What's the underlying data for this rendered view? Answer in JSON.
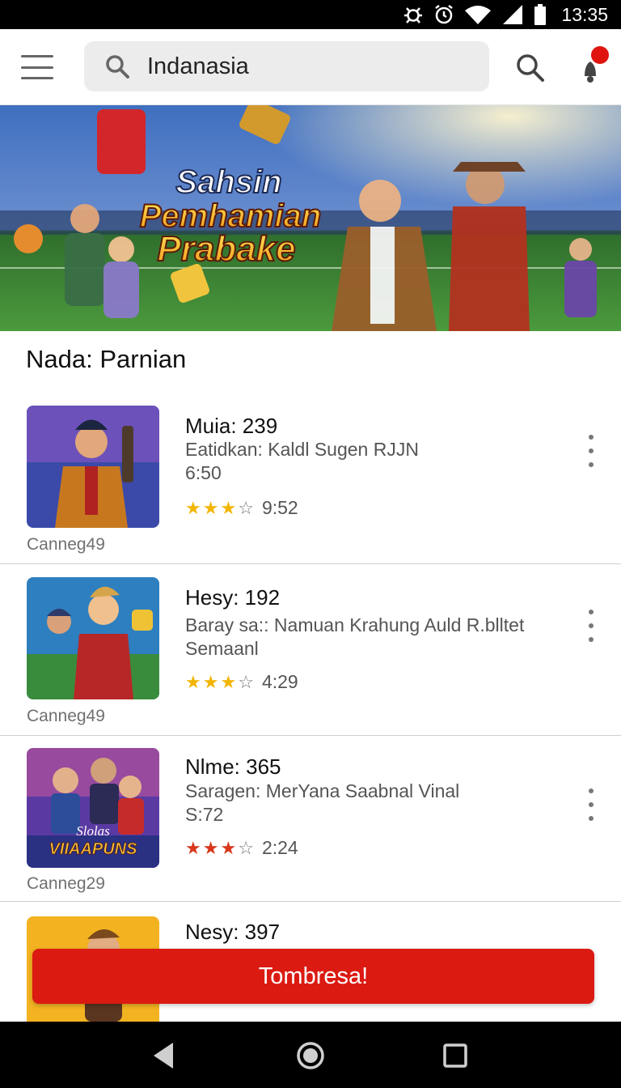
{
  "status_bar": {
    "time": "13:35",
    "icons": [
      "bug-icon",
      "alarm-icon",
      "wifi-icon",
      "signal-icon",
      "battery-icon"
    ]
  },
  "app_bar": {
    "menu_icon": "menu-icon",
    "search": {
      "value": "Indanasia",
      "icon": "search-icon"
    },
    "search_button_icon": "search-icon",
    "notification_icon": "notification-icon",
    "notification_badge_color": "#e0140f"
  },
  "banner": {
    "line1": "Sahsin",
    "line2": "Pemhamian",
    "line3": "Prabake"
  },
  "section_title": "Nada: Parnian",
  "items": [
    {
      "title": "Muia: 239",
      "desc_line1": "Eatidkan: Kaldl Sugen RJJN",
      "desc_line2": "6:50",
      "stars": 3,
      "rating_text": "9:52",
      "caption": "Canneg49"
    },
    {
      "title": "Hesy: 192",
      "desc_line1": "Baray sa:: Namuan Krahung Auld R.blltet",
      "desc_line2": "Semaanl",
      "stars": 3,
      "rating_text": "4:29",
      "caption": "Canneg49"
    },
    {
      "title": "Nlme: 365",
      "desc_line1": "Saragen: MerYana Saabnal Vinal",
      "desc_line2": "S:72",
      "stars": 3,
      "rating_text": "2:24",
      "caption": "Canneg29",
      "thumb_text_1": "Slolas",
      "thumb_text_2": "VIIAAPUNS"
    },
    {
      "title": "Nesy: 397"
    }
  ],
  "cta_label": "Tombresa!",
  "nav": {
    "back_icon": "back-icon",
    "home_icon": "home-icon",
    "recents_icon": "recents-icon"
  },
  "colors": {
    "accent_red": "#db1a12",
    "star_gold": "#f2b500",
    "star_red": "#d9361b"
  }
}
